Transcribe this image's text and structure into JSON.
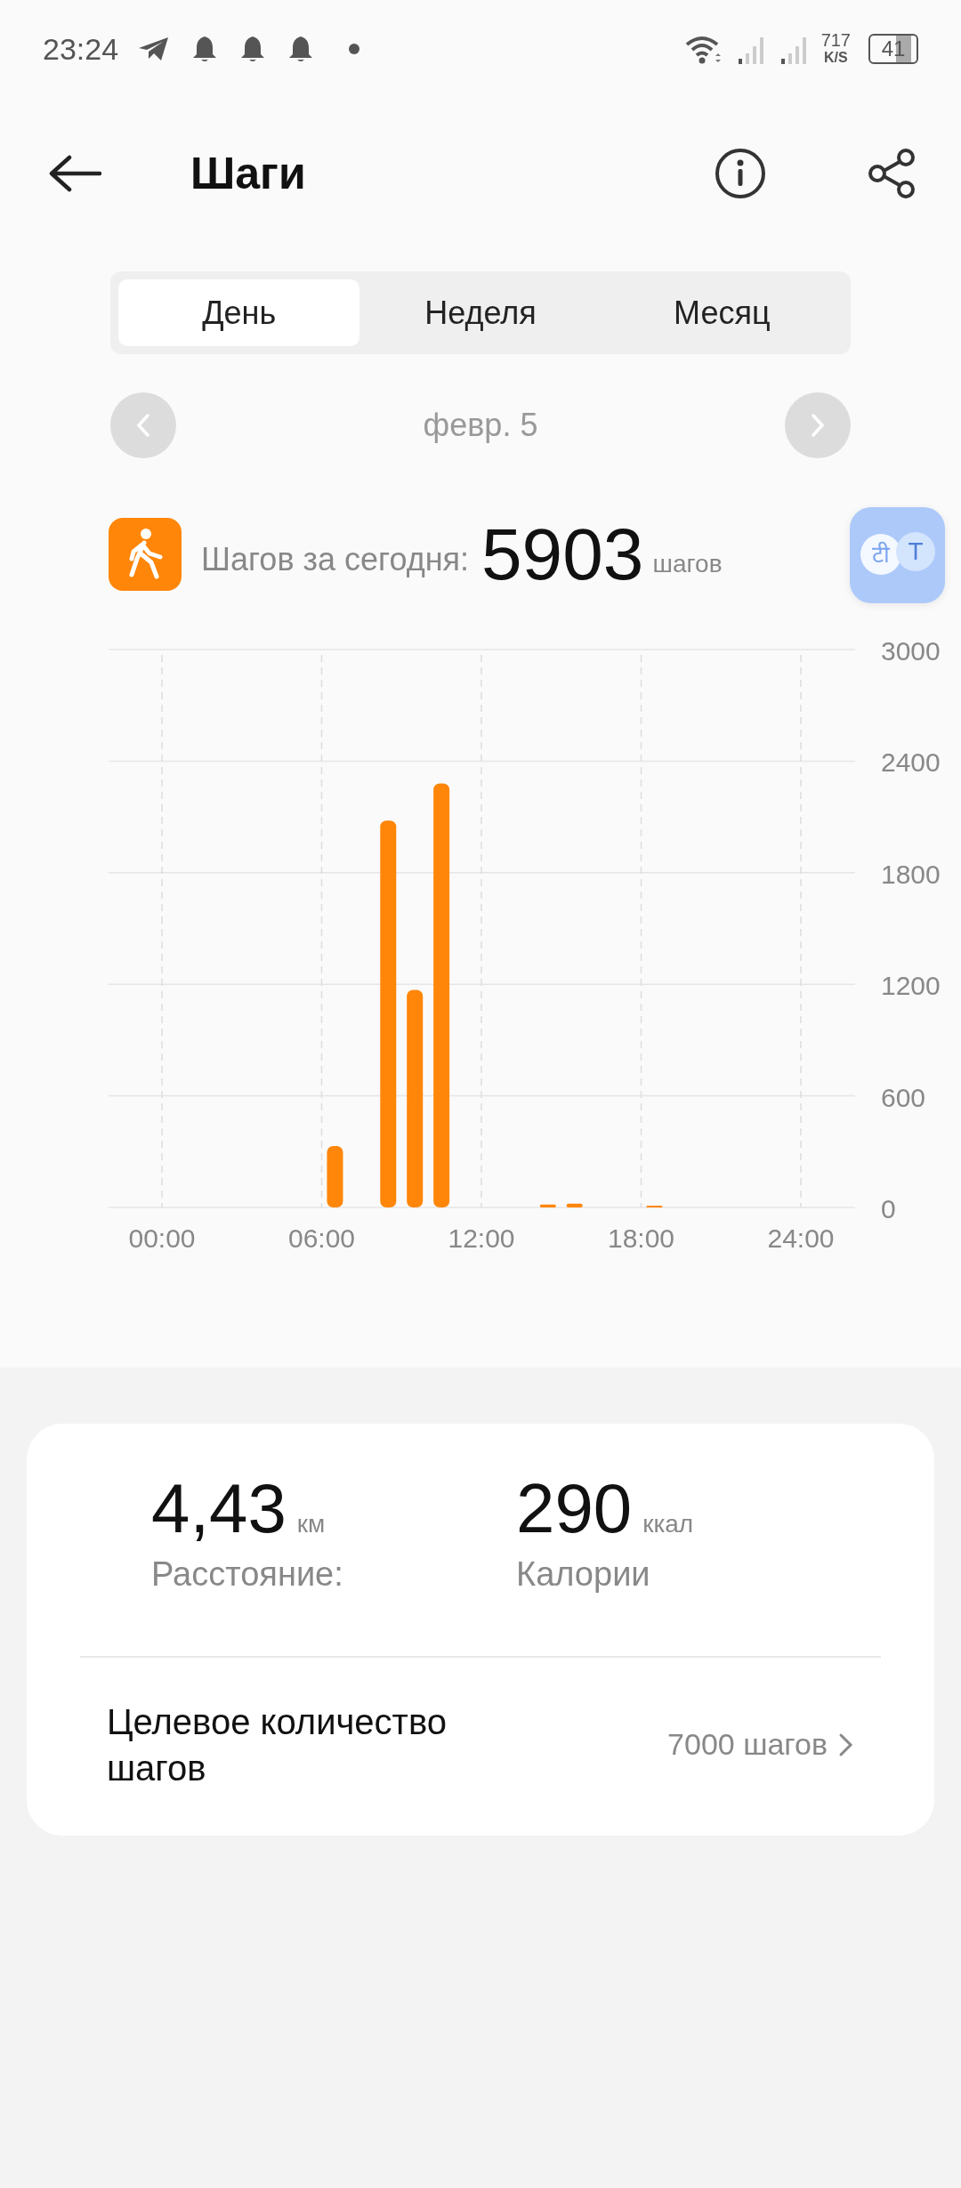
{
  "status_bar": {
    "time": "23:24",
    "net_speed": "717",
    "net_unit": "K/S",
    "battery": "41"
  },
  "header": {
    "title": "Шаги"
  },
  "tabs": [
    {
      "label": "День",
      "selected": true
    },
    {
      "label": "Неделя",
      "selected": false
    },
    {
      "label": "Месяц",
      "selected": false
    }
  ],
  "date_nav": {
    "date": "февр. 5"
  },
  "summary": {
    "label": "Шагов за сегодня:",
    "value": "5903",
    "unit": "шагов"
  },
  "translate_button": {
    "glyphs": [
      "टी",
      "T"
    ]
  },
  "chart": {
    "chart_data": {
      "type": "bar",
      "x": [
        6.5,
        8.5,
        9.5,
        10.5,
        14.5,
        15.5,
        18.5
      ],
      "values": [
        330,
        2080,
        1170,
        2280,
        15,
        20,
        8
      ],
      "xlim": [
        0,
        24
      ],
      "ylim": [
        0,
        3000
      ],
      "xticks": [
        {
          "value": 0,
          "label": "00:00"
        },
        {
          "value": 6,
          "label": "06:00"
        },
        {
          "value": 12,
          "label": "12:00"
        },
        {
          "value": 18,
          "label": "18:00"
        },
        {
          "value": 24,
          "label": "24:00"
        }
      ],
      "yticks": [
        0,
        600,
        1200,
        1800,
        2400,
        3000
      ],
      "grid": true
    }
  },
  "stats": [
    {
      "value": "4,43",
      "unit": "км",
      "label": "Расстояние:"
    },
    {
      "value": "290",
      "unit": "ккал",
      "label": "Калории"
    }
  ],
  "goal": {
    "label": "Целевое количество шагов",
    "value": "7000 шагов"
  }
}
